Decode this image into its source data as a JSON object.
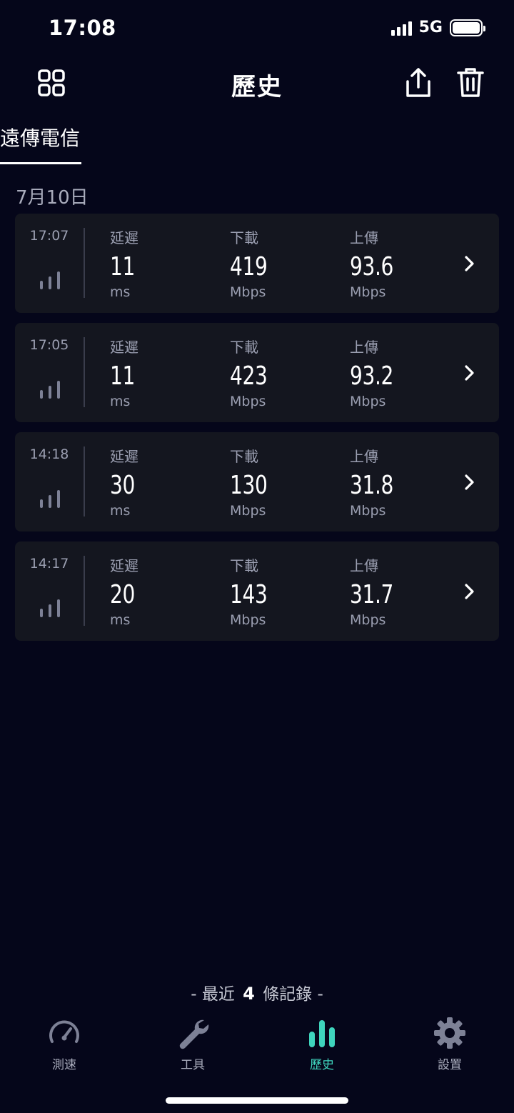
{
  "status_bar": {
    "time": "17:08",
    "network": "5G"
  },
  "header": {
    "title": "歷史"
  },
  "carrier_tab": {
    "label": "遠傳電信"
  },
  "date_group": {
    "label": "7月10日"
  },
  "labels": {
    "latency": "延遲",
    "download": "下載",
    "upload": "上傳",
    "latency_unit": "ms",
    "speed_unit": "Mbps"
  },
  "records": [
    {
      "time": "17:07",
      "latency": "11",
      "download": "419",
      "upload": "93.6"
    },
    {
      "time": "17:05",
      "latency": "11",
      "download": "423",
      "upload": "93.2"
    },
    {
      "time": "14:18",
      "latency": "30",
      "download": "130",
      "upload": "31.8"
    },
    {
      "time": "14:17",
      "latency": "20",
      "download": "143",
      "upload": "31.7"
    }
  ],
  "footer": {
    "prefix": "-  最近",
    "count": "4",
    "suffix": "條記錄  -"
  },
  "tabbar": {
    "items": [
      {
        "label": "測速",
        "icon": "speedometer-icon"
      },
      {
        "label": "工具",
        "icon": "wrench-icon"
      },
      {
        "label": "歷史",
        "icon": "bar-chart-icon"
      },
      {
        "label": "設置",
        "icon": "gear-icon"
      }
    ],
    "active": "歷史"
  },
  "colors": {
    "accent": "#3fd5bd",
    "background": "#05061a",
    "card": "#14161f"
  }
}
